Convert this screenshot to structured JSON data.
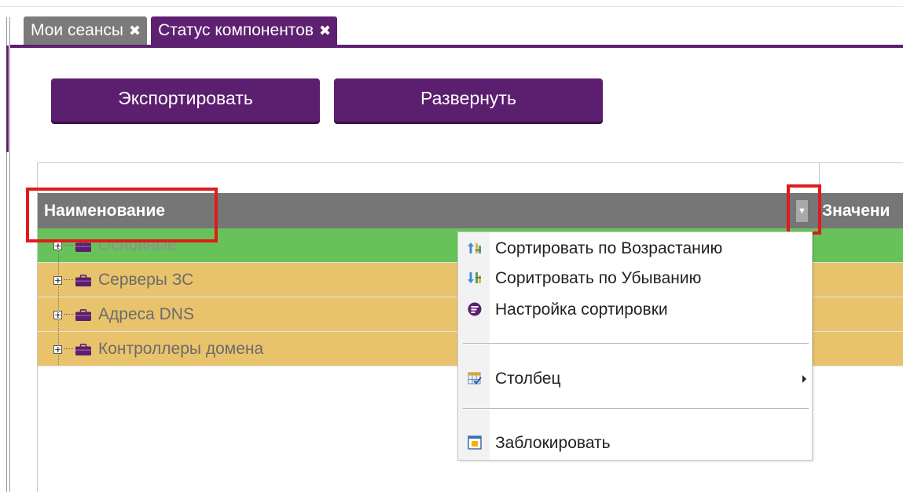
{
  "tabs": [
    {
      "label": "Мои сеансы",
      "close": "✖",
      "active": false
    },
    {
      "label": "Статус компонентов",
      "close": "✖",
      "active": true
    }
  ],
  "toolbar": {
    "export_label": "Экспортировать",
    "expand_label": "Развернуть"
  },
  "grid": {
    "columns": {
      "name": "Наименование",
      "value": "Значени",
      "menu_glyph": "▼"
    },
    "rows": [
      {
        "label": "Основные",
        "icon": "briefcase-icon",
        "status": "green"
      },
      {
        "label": "Серверы ЗС",
        "icon": "briefcase-icon",
        "status": "orange"
      },
      {
        "label": "Адреса DNS",
        "icon": "briefcase-icon",
        "status": "orange"
      },
      {
        "label": "Контроллеры домена",
        "icon": "briefcase-icon",
        "status": "orange"
      }
    ],
    "expander_glyph": "+"
  },
  "context_menu": {
    "items": [
      {
        "label": "Сортировать по Возрастанию",
        "icon": "sort-ascending-icon"
      },
      {
        "label": "Соритровать по Убыванию",
        "icon": "sort-descending-icon"
      },
      {
        "label": "Настройка сортировки",
        "icon": "sort-settings-icon"
      },
      {
        "label": "Столбец",
        "icon": "columns-icon",
        "submenu": true
      },
      {
        "label": "Заблокировать",
        "icon": "lock-column-icon"
      }
    ]
  },
  "colors": {
    "accent": "#5e2070",
    "row_ok": "#68c25a",
    "row_warn": "#e9c36c",
    "highlight": "#e01b1b"
  }
}
